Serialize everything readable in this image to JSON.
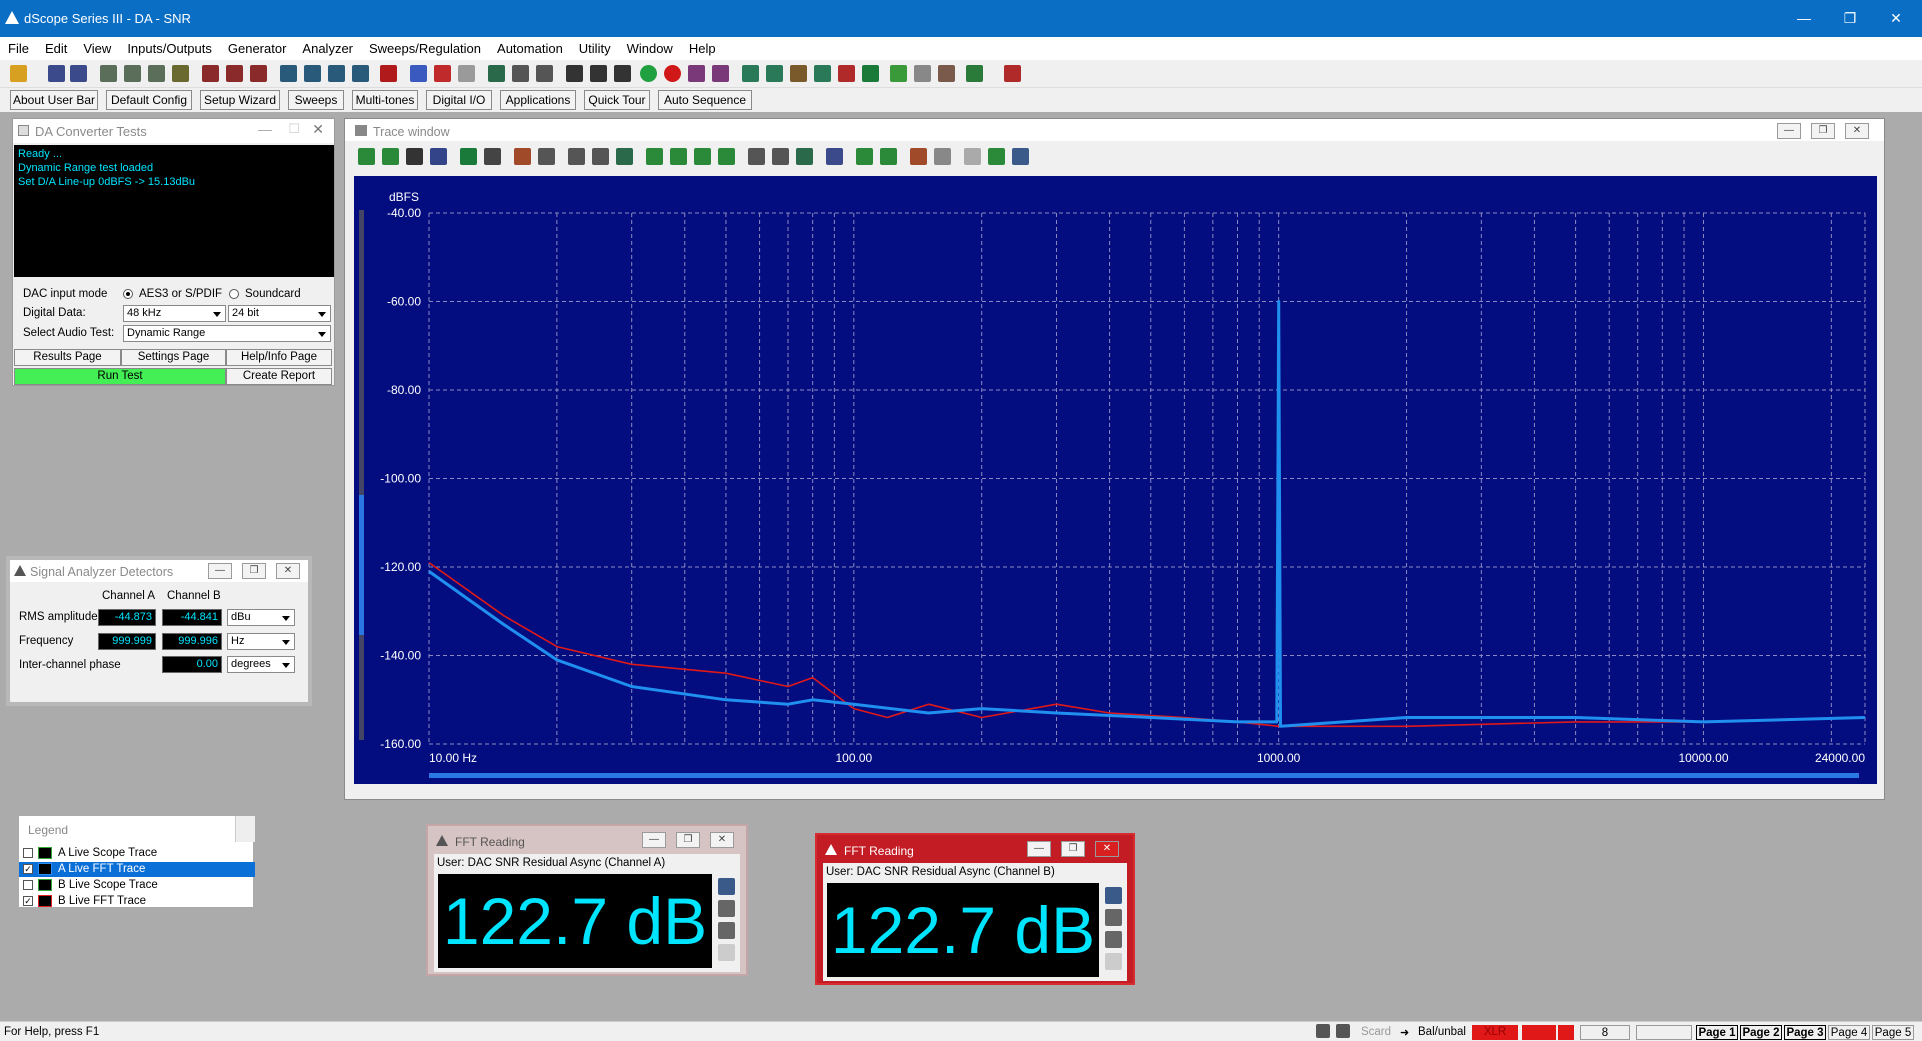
{
  "window": {
    "title": "dScope Series III - DA - SNR",
    "min": "—",
    "max": "❐",
    "close": "✕"
  },
  "menu": [
    "File",
    "Edit",
    "View",
    "Inputs/Outputs",
    "Generator",
    "Analyzer",
    "Sweeps/Regulation",
    "Automation",
    "Utility",
    "Window",
    "Help"
  ],
  "userbar": [
    "About User Bar",
    "Default Config",
    "Setup Wizard",
    "Sweeps",
    "Multi-tones",
    "Digital I/O",
    "Applications",
    "Quick Tour",
    "Auto Sequence"
  ],
  "da": {
    "title": "DA Converter Tests",
    "console": [
      "Ready ...",
      "Dynamic Range test loaded",
      "Set D/A Line-up 0dBFS -> 15.13dBu"
    ],
    "input_mode_label": "DAC input mode",
    "opt1": "AES3 or S/PDIF",
    "opt2": "Soundcard",
    "digital_label": "Digital Data:",
    "rate": "48 kHz",
    "bits": "24 bit",
    "audio_test_label": "Select Audio Test:",
    "audio_test": "Dynamic Range",
    "results": "Results Page",
    "settings": "Settings Page",
    "help": "Help/Info Page",
    "run": "Run Test",
    "report": "Create Report"
  },
  "det": {
    "title": "Signal Analyzer Detectors",
    "cha": "Channel A",
    "chb": "Channel B",
    "rms_label": "RMS amplitude",
    "rms_a": "-44.873",
    "rms_b": "-44.841",
    "rms_unit": "dBu",
    "freq_label": "Frequency",
    "freq_a": "999.999",
    "freq_b": "999.996",
    "freq_unit": "Hz",
    "phase_label": "Inter-channel phase",
    "phase": "0.00",
    "phase_unit": "degrees"
  },
  "trace": {
    "title": "Trace window"
  },
  "chart_data": {
    "type": "line",
    "ylabel": "dBFS",
    "x_scale": "log",
    "xlim": [
      10,
      24000
    ],
    "ylim": [
      -160,
      -40
    ],
    "xticks": [
      "10.00 Hz",
      "100.00",
      "1000.00",
      "10000.00",
      "24000.00"
    ],
    "yticks": [
      "-40.00",
      "-60.00",
      "-80.00",
      "-100.00",
      "-120.00",
      "-140.00",
      "-160.00"
    ],
    "grid": true,
    "series": [
      {
        "label": "B Live FFT Trace",
        "color": "#e01818",
        "points": [
          [
            10,
            -119
          ],
          [
            15,
            -131
          ],
          [
            20,
            -138
          ],
          [
            30,
            -142
          ],
          [
            50,
            -144
          ],
          [
            70,
            -147
          ],
          [
            80,
            -145
          ],
          [
            100,
            -152
          ],
          [
            120,
            -154
          ],
          [
            150,
            -151
          ],
          [
            200,
            -154
          ],
          [
            300,
            -151
          ],
          [
            400,
            -153
          ],
          [
            600,
            -154
          ],
          [
            800,
            -155
          ],
          [
            1000,
            -156
          ],
          [
            2000,
            -156
          ],
          [
            5000,
            -155
          ],
          [
            10000,
            -155
          ],
          [
            24000,
            -154
          ]
        ]
      },
      {
        "label": "A Live FFT Trace",
        "color": "#1f8ff0",
        "points": [
          [
            10,
            -121
          ],
          [
            15,
            -133
          ],
          [
            20,
            -141
          ],
          [
            30,
            -147
          ],
          [
            50,
            -150
          ],
          [
            70,
            -151
          ],
          [
            80,
            -150
          ],
          [
            100,
            -151
          ],
          [
            150,
            -153
          ],
          [
            200,
            -152
          ],
          [
            300,
            -153
          ],
          [
            500,
            -154
          ],
          [
            800,
            -155
          ],
          [
            990,
            -155
          ],
          [
            1000,
            -60
          ],
          [
            1010,
            -156
          ],
          [
            2000,
            -154
          ],
          [
            5000,
            -154
          ],
          [
            10000,
            -155
          ],
          [
            24000,
            -154
          ]
        ]
      }
    ]
  },
  "legend": {
    "title": "Legend",
    "items": [
      {
        "label": "A  Live Scope Trace",
        "checked": false
      },
      {
        "label": "A  Live FFT Trace",
        "checked": true
      },
      {
        "label": "B  Live Scope Trace",
        "checked": false
      },
      {
        "label": "B  Live FFT Trace",
        "checked": true
      }
    ]
  },
  "fftA": {
    "title": "FFT Reading",
    "user": "User: DAC SNR Residual Async (Channel A)",
    "value": "122.7 dB"
  },
  "fftB": {
    "title": "FFT Reading",
    "user": "User: DAC SNR Residual Async (Channel B)",
    "value": "122.7 dB"
  },
  "status": {
    "help": "For Help, press F1",
    "card": "Scard",
    "balunbal": "Bal/unbal",
    "xlr": "XLR",
    "num": "8",
    "pages": [
      "Page 1",
      "Page 2",
      "Page 3",
      "Page 4",
      "Page 5"
    ]
  }
}
